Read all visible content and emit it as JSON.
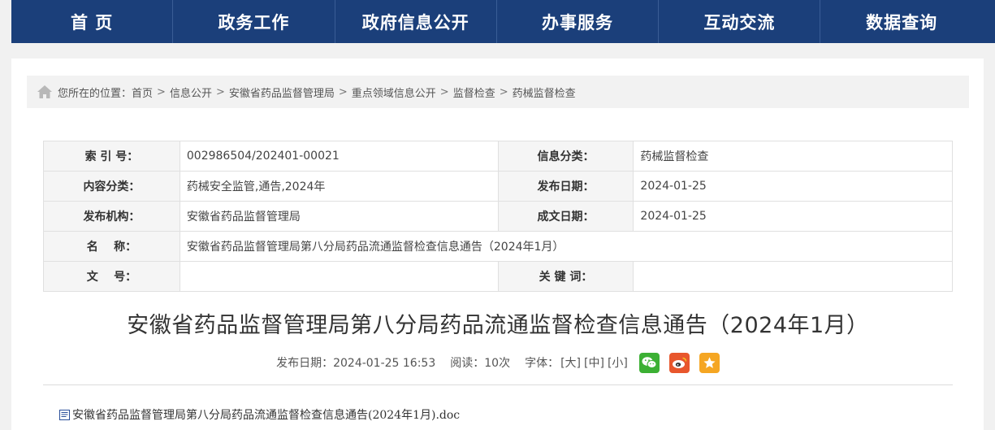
{
  "nav": {
    "items": [
      "首 页",
      "政务工作",
      "政府信息公开",
      "办事服务",
      "互动交流",
      "数据查询"
    ]
  },
  "breadcrumb": {
    "prefix": "您所在的位置：",
    "items": [
      "首页",
      "信息公开",
      "安徽省药品监督管理局",
      "重点领域信息公开",
      "监督检查",
      "药械监督检查"
    ],
    "separator": ">"
  },
  "meta": {
    "index_label": "索 引 号：",
    "index_value": "002986504/202401-00021",
    "category_label": "信息分类：",
    "category_value": "药械监督检查",
    "content_label": "内容分类：",
    "content_value": "药械安全监管,通告,2024年",
    "pubdate_label": "发布日期：",
    "pubdate_value": "2024-01-25",
    "org_label": "发布机构：",
    "org_value": "安徽省药品监督管理局",
    "docdate_label": "成文日期：",
    "docdate_value": "2024-01-25",
    "name_label": "名    称：",
    "name_value": "安徽省药品监督管理局第八分局药品流通监督检查信息通告（2024年1月）",
    "docno_label": "文    号：",
    "docno_value": "",
    "keyword_label": "关 键 词：",
    "keyword_value": ""
  },
  "article": {
    "title": "安徽省药品监督管理局第八分局药品流通监督检查信息通告（2024年1月）",
    "pub_label": "发布日期：2024-01-25 16:53",
    "reads_label": "阅读：10次",
    "font_label": "字体：",
    "font_large": "[大]",
    "font_medium": "[中]",
    "font_small": "[小]"
  },
  "attachment": {
    "name": "安徽省药品监督管理局第八分局药品流通监督检查信息通告(2024年1月).doc"
  },
  "colors": {
    "nav_bg": "#1b3f7a",
    "wechat": "#3cb034",
    "weibo": "#e8562c",
    "favorite": "#f5a623"
  }
}
